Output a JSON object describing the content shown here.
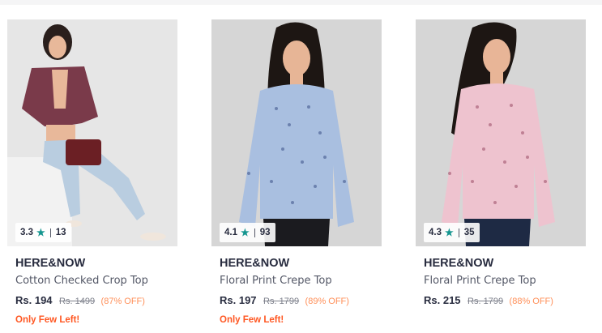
{
  "products": [
    {
      "brand": "HERE&NOW",
      "name": "Cotton Checked Crop Top",
      "rating": "3.3",
      "rating_count": "13",
      "price": "Rs. 194",
      "mrp": "Rs. 1499",
      "discount": "(87% OFF)",
      "stock_note": "Only Few Left!",
      "image_colors": {
        "background": "#e6e6e6",
        "top": "#7a3a4a",
        "bottom": "#b9cde0",
        "skin": "#e8b89a",
        "hair": "#2a1f1c"
      }
    },
    {
      "brand": "HERE&NOW",
      "name": "Floral Print Crepe Top",
      "rating": "4.1",
      "rating_count": "93",
      "price": "Rs. 197",
      "mrp": "Rs. 1799",
      "discount": "(89% OFF)",
      "stock_note": "Only Few Left!",
      "image_colors": {
        "background": "#d6d6d6",
        "top": "#a9bfe0",
        "bottom": "#1b1b1f",
        "skin": "#e7b596",
        "hair": "#1d1613"
      }
    },
    {
      "brand": "HERE&NOW",
      "name": "Floral Print Crepe Top",
      "rating": "4.3",
      "rating_count": "35",
      "price": "Rs. 215",
      "mrp": "Rs. 1799",
      "discount": "(88% OFF)",
      "stock_note": "",
      "image_colors": {
        "background": "#d6d6d6",
        "top": "#eec3cf",
        "bottom": "#1e2a44",
        "skin": "#e8b597",
        "hair": "#1d1613"
      }
    }
  ],
  "icons": {
    "rating_star": "star-icon"
  },
  "colors": {
    "rating_star": "#14958f",
    "discount": "#ff905a",
    "stock_note": "#ff5722"
  }
}
